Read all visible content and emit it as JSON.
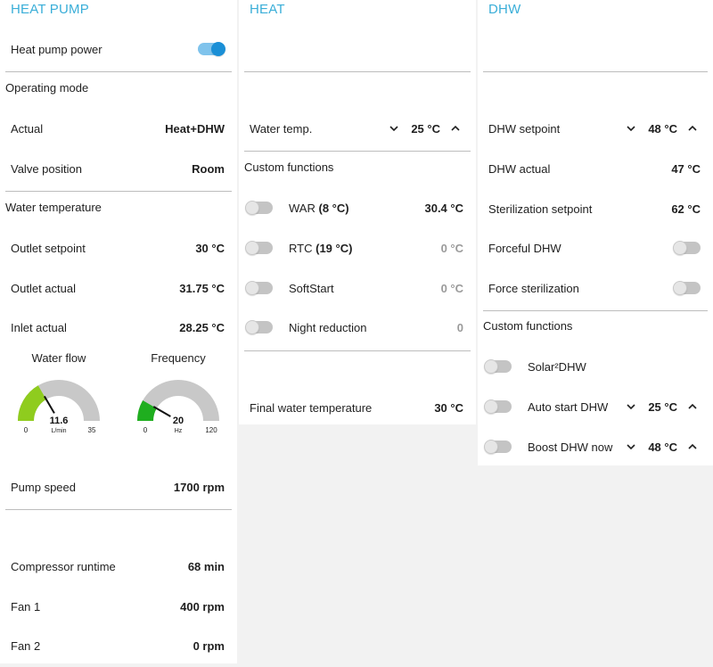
{
  "heat_pump": {
    "title": "HEAT PUMP",
    "power_label": "Heat pump power",
    "power_on": true,
    "operating_mode": {
      "title": "Operating mode",
      "actual_label": "Actual",
      "actual_value": "Heat+DHW",
      "valve_label": "Valve position",
      "valve_value": "Room"
    },
    "water_temperature": {
      "title": "Water temperature",
      "outlet_setpoint_label": "Outlet setpoint",
      "outlet_setpoint_value": "30 °C",
      "outlet_actual_label": "Outlet actual",
      "outlet_actual_value": "31.75 °C",
      "inlet_actual_label": "Inlet actual",
      "inlet_actual_value": "28.25 °C"
    },
    "water_flow": {
      "label": "Water flow",
      "value": 11.6,
      "value_text": "11.6",
      "unit": "L/min",
      "min": 0,
      "max": 35,
      "min_text": "0",
      "max_text": "35",
      "color": "#8fcc1e"
    },
    "frequency": {
      "label": "Frequency",
      "value": 20,
      "value_text": "20",
      "unit": "Hz",
      "min": 0,
      "max": 120,
      "min_text": "0",
      "max_text": "120",
      "color": "#1fae1f"
    },
    "pump_speed_label": "Pump speed",
    "pump_speed_value": "1700 rpm",
    "compressor_runtime_label": "Compressor runtime",
    "compressor_runtime_value": "68 min",
    "fan1_label": "Fan 1",
    "fan1_value": "400 rpm",
    "fan2_label": "Fan 2",
    "fan2_value": "0 rpm"
  },
  "heat": {
    "title": "HEAT",
    "water_temp_label": "Water temp.",
    "water_temp_value": "25 °C",
    "custom_functions_title": "Custom functions",
    "war_label": "WAR",
    "war_sub": "(8 °C)",
    "war_value": "30.4 °C",
    "rtc_label": "RTC",
    "rtc_sub": "(19 °C)",
    "rtc_value": "0 °C",
    "softstart_label": "SoftStart",
    "softstart_value": "0 °C",
    "night_label": "Night reduction",
    "night_value": "0",
    "final_label": "Final water temperature",
    "final_value": "30 °C"
  },
  "dhw": {
    "title": "DHW",
    "setpoint_label": "DHW setpoint",
    "setpoint_value": "48 °C",
    "actual_label": "DHW actual",
    "actual_value": "47 °C",
    "steril_setpoint_label": "Sterilization setpoint",
    "steril_setpoint_value": "62 °C",
    "forceful_label": "Forceful DHW",
    "force_steril_label": "Force sterilization",
    "custom_functions_title": "Custom functions",
    "solar_label": "Solar²DHW",
    "auto_start_label": "Auto start DHW",
    "auto_start_value": "25 °C",
    "boost_label": "Boost DHW now",
    "boost_value": "48 °C"
  }
}
